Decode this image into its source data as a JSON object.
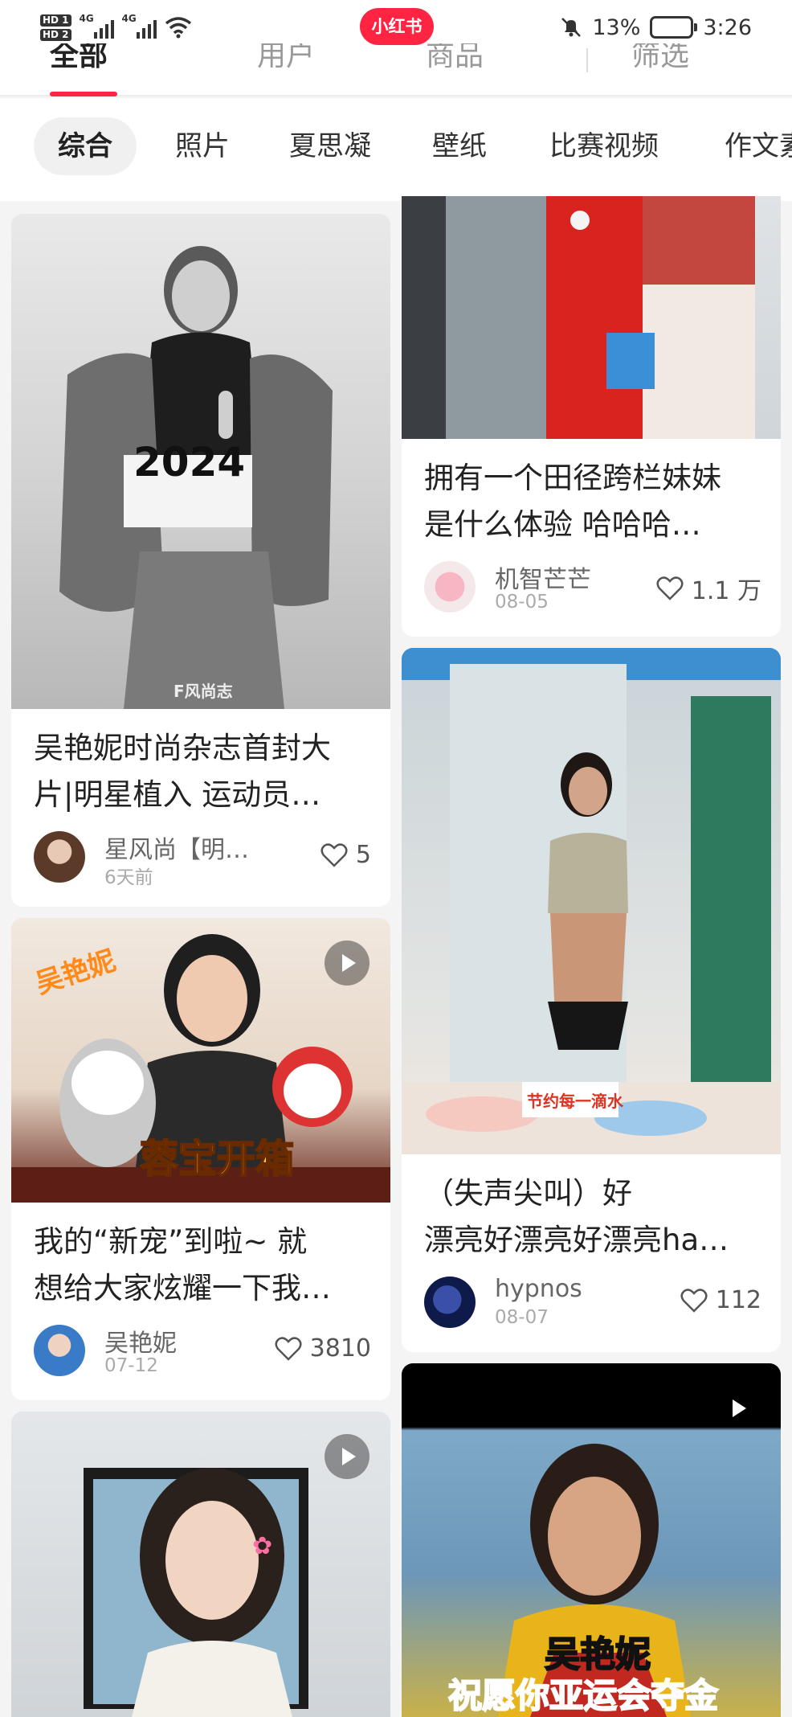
{
  "status_bar": {
    "sim1": "HD 1",
    "sim2": "HD 2",
    "net1": "4G",
    "net2": "4G",
    "app_logo": "小红书",
    "battery": "13%",
    "time": "3:26",
    "icons": [
      "signal-icon",
      "wifi-icon",
      "mute-bell-icon",
      "battery-icon"
    ]
  },
  "top_tabs": [
    "全部",
    "用户",
    "商品",
    "筛选"
  ],
  "chips": {
    "active": "综合",
    "items": [
      "照片",
      "夏思凝",
      "壁纸",
      "比赛视频",
      "作文素材"
    ]
  },
  "colors": {
    "accent": "#ff2442",
    "text": "#222222",
    "secondary": "#999999"
  },
  "cards": [
    {
      "title_line1": "吴艳妮时尚杂志首封大",
      "title_line2": "片|明星植入 运动员…",
      "author": "星风尚【明…",
      "date": "6天前",
      "likes": "5",
      "image_text": "2024",
      "image_watermark": "F风尚志",
      "is_video": false
    },
    {
      "title_line1": "我的“新宠”到啦~ 就",
      "title_line2": "想给大家炫耀一下我…",
      "author": "吴艳妮",
      "date": "07-12",
      "likes": "3810",
      "image_text": "吴艳妮",
      "image_text2": "蓉宝开箱",
      "is_video": true
    },
    {
      "is_video": true,
      "image_icon": "flower-icon"
    },
    {
      "title_line1": "拥有一个田径跨栏妹妹",
      "title_line2": "是什么体验 哈哈哈…",
      "author": "机智芒芒",
      "date": "08-05",
      "likes": "1.1 万",
      "is_video": false
    },
    {
      "title_line1": "（失声尖叫）好",
      "title_line2": "漂亮好漂亮好漂亮ha…",
      "author": "hypnos",
      "date": "08-07",
      "likes": "112",
      "image_text": "节约每一滴水",
      "is_video": false
    },
    {
      "is_video": true,
      "image_text": "吴艳妮",
      "image_text2": "祝愿你亚运会夺金"
    }
  ]
}
